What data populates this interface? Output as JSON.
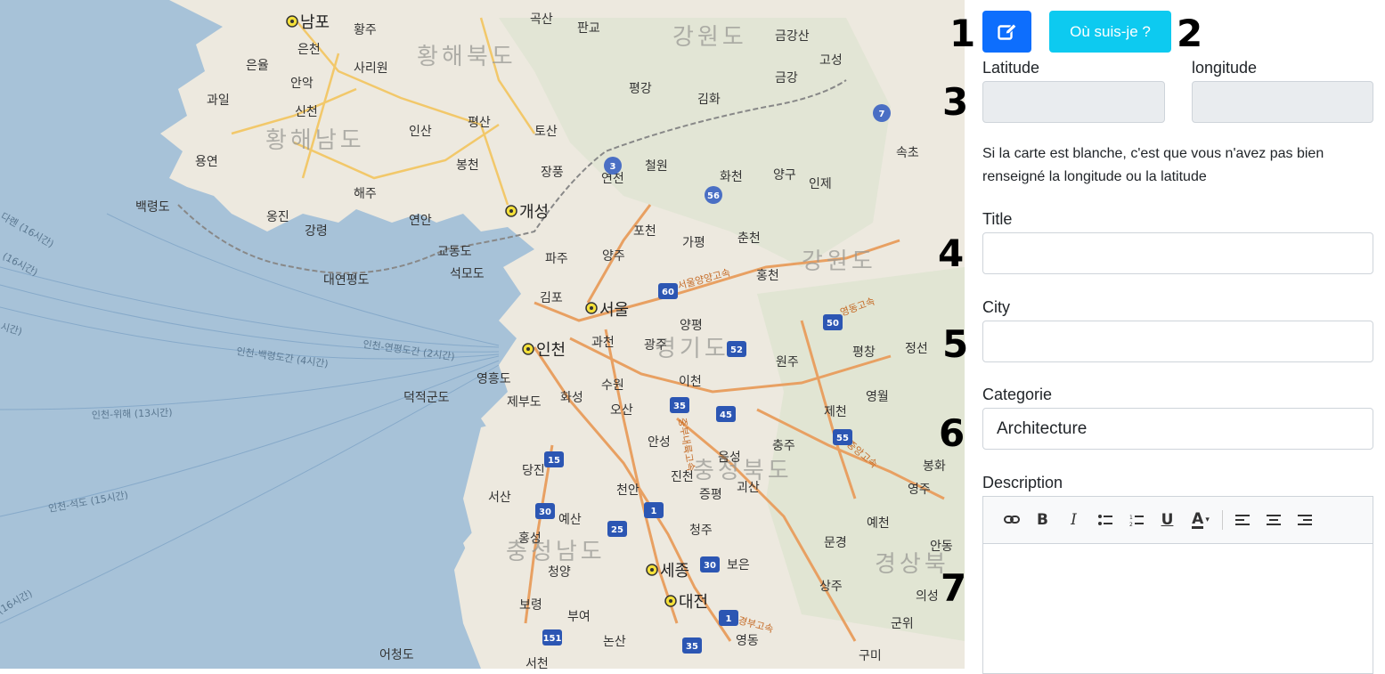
{
  "map": {
    "cities": [
      "남포",
      "은천",
      "황주",
      "은율",
      "사리원",
      "과일",
      "신천",
      "안악",
      "용연",
      "인산",
      "평산",
      "개성",
      "해주",
      "옹진",
      "강령",
      "연안",
      "판교",
      "곡산",
      "토산",
      "장풍",
      "봉천",
      "금강산",
      "고성",
      "금강",
      "평강",
      "김화",
      "철원",
      "연천",
      "화천",
      "양구",
      "인제",
      "속초",
      "포천",
      "가평",
      "춘천",
      "파주",
      "양주",
      "김포",
      "서울",
      "인천",
      "과천",
      "광주",
      "양평",
      "홍천",
      "원주",
      "평창",
      "정선",
      "수원",
      "화성",
      "이천",
      "오산",
      "제천",
      "영월",
      "충주",
      "음성",
      "진천",
      "증평",
      "괴산",
      "안성",
      "천안",
      "당진",
      "서산",
      "예산",
      "홍성",
      "청양",
      "보령",
      "부여",
      "세종",
      "대전",
      "청주",
      "보은",
      "논산",
      "문경",
      "상주",
      "예천",
      "안동",
      "영주",
      "봉화",
      "의성",
      "군위",
      "구미",
      "영동",
      "제부도",
      "영흥도",
      "교동도",
      "석모도",
      "대연평도",
      "백령도",
      "덕적군도",
      "어청도",
      "서천"
    ],
    "provinces": [
      "강원도",
      "황해북도",
      "황해남도",
      "경기도",
      "충청북도",
      "충청남도",
      "강원도",
      "경상북"
    ],
    "routes": [
      "인천-백령도간 (4시간)",
      "인천-연평도간 (2시간)",
      "인천-위해 (13시간)",
      "인천-석도 (15시간)",
      "다롄 (16시간)",
      "(16시간)",
      "(16시간)",
      "시간)"
    ],
    "shields": [
      "3",
      "7",
      "56",
      "60",
      "50",
      "52",
      "35",
      "45",
      "55",
      "15",
      "30",
      "1",
      "25",
      "30",
      "1",
      "151",
      "35"
    ],
    "highway_labels": [
      "서울양양고속",
      "영동고속",
      "중부내륙고속",
      "중앙고속",
      "경부고속"
    ]
  },
  "steps": [
    "1",
    "2",
    "3",
    "4",
    "5",
    "6",
    "7"
  ],
  "buttons": {
    "locate_label": "Où suis-je ?"
  },
  "fields": {
    "latitude_label": "Latitude",
    "longitude_label": "longitude",
    "latitude_value": "",
    "longitude_value": "",
    "help_text": "Si la carte est blanche, c'est que vous n'avez pas bien renseigné la longitude ou la latitude",
    "title_label": "Title",
    "title_value": "",
    "city_label": "City",
    "city_value": "",
    "category_label": "Categorie",
    "category_value": "Architecture",
    "description_label": "Description"
  },
  "toolbar": [
    "link-icon",
    "bold-icon",
    "italic-icon",
    "bullet-list-icon",
    "numbered-list-icon",
    "underline-icon",
    "text-color-icon",
    "align-left-icon",
    "align-center-icon",
    "align-right-icon"
  ],
  "colors": {
    "primary": "#0d6efd",
    "info": "#0dcaf0"
  }
}
